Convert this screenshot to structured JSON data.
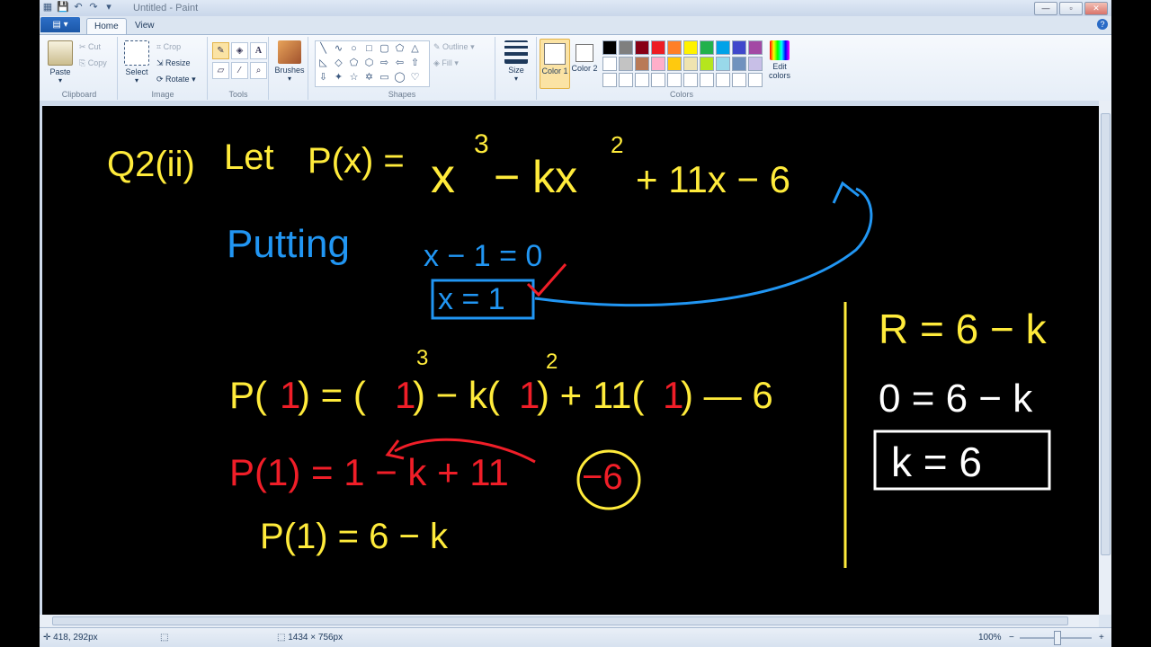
{
  "window": {
    "title": "Untitled - Paint",
    "controls": {
      "minimize": "—",
      "maximize": "▫",
      "close": "✕"
    }
  },
  "tabs": {
    "file": "▤ ▾",
    "home": "Home",
    "view": "View"
  },
  "ribbon": {
    "clipboard": {
      "label": "Clipboard",
      "paste": "Paste",
      "cut": "Cut",
      "copy": "Copy"
    },
    "image": {
      "label": "Image",
      "select": "Select",
      "crop": "Crop",
      "resize": "Resize",
      "rotate": "Rotate"
    },
    "tools": {
      "label": "Tools"
    },
    "brushes": {
      "label": "Brushes"
    },
    "shapes": {
      "label": "Shapes",
      "outline": "Outline",
      "fill": "Fill"
    },
    "size": {
      "label": "Size"
    },
    "colors": {
      "label": "Colors",
      "color1": "Color 1",
      "color2": "Color 2",
      "edit": "Edit colors",
      "palette_row1": [
        "#000000",
        "#7f7f7f",
        "#880015",
        "#ed1c24",
        "#ff7f27",
        "#fff200",
        "#22b14c",
        "#00a2e8",
        "#3f48cc",
        "#a349a4"
      ],
      "palette_row2": [
        "#ffffff",
        "#c3c3c3",
        "#b97a57",
        "#ffaec9",
        "#ffc90e",
        "#efe4b0",
        "#b5e61d",
        "#99d9ea",
        "#7092be",
        "#c8bfe7"
      ],
      "palette_row3": [
        "#ffffff",
        "#ffffff",
        "#ffffff",
        "#ffffff",
        "#ffffff",
        "#ffffff",
        "#ffffff",
        "#ffffff",
        "#ffffff",
        "#ffffff"
      ]
    }
  },
  "canvas": {
    "strokes": {
      "yellow": "#ffeb3b",
      "blue": "#2196f3",
      "red": "#f01e28",
      "white": "#ffffff"
    },
    "text": {
      "q_label": "Q2(ii)",
      "let_label": "Let",
      "px_eq": "P(x) =",
      "poly_x": "x",
      "poly_e3": "3",
      "poly_minus_k": "− kx",
      "poly_e2": "2",
      "poly_rest": "+ 11x − 6",
      "putting": "Putting",
      "x_minus_1": "x − 1 = 0",
      "x_eq_1": "x = 1",
      "p1_lhs": "P(",
      "p1_one": "1",
      "p1_mid1": ") = (",
      "p1_one_b": "1",
      "p1_mid2": ") − k(",
      "p1_one_c": "1",
      "p1_mid3": ") + 11(",
      "p1_one_d": "1",
      "p1_end": ") — 6",
      "p1_exp3": "3",
      "p1_exp2": "2",
      "red_line": "P(1) = 1 − k + 11",
      "red_circled": "−6",
      "pc1": "P(1) = 6 − k",
      "r_eq": "R = 6 − k",
      "zero_eq": "0 = 6 − k",
      "k_eq": "k = 6"
    }
  },
  "status": {
    "cursor": "418, 292px",
    "size": "1434 × 756px",
    "zoom": "100%",
    "zoom_out": "−",
    "zoom_in": "+"
  }
}
